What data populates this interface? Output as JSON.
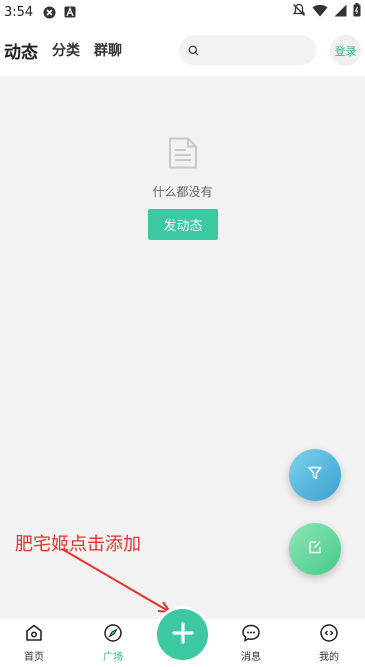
{
  "status_bar": {
    "time": "3:54",
    "icons": [
      "notification-icon",
      "a-icon",
      "mute-icon",
      "wifi-icon",
      "signal-icon",
      "battery-icon"
    ]
  },
  "header": {
    "tabs": [
      {
        "label": "动态",
        "active": true
      },
      {
        "label": "分类",
        "active": false
      },
      {
        "label": "群聊",
        "active": false
      }
    ],
    "search": {
      "placeholder": "",
      "value": ""
    },
    "login_label": "登录"
  },
  "main": {
    "empty_text": "什么都没有",
    "post_button_label": "发动态"
  },
  "annotation": {
    "text": "肥宅姬点击添加"
  },
  "bottom_nav": {
    "items": [
      {
        "label": "首页",
        "icon": "home-icon",
        "active": false
      },
      {
        "label": "广场",
        "icon": "compass-icon",
        "active": true
      },
      {
        "label": "消息",
        "icon": "chat-icon",
        "active": false
      },
      {
        "label": "我的",
        "icon": "profile-icon",
        "active": false
      }
    ]
  },
  "colors": {
    "accent": "#3cc8a0",
    "annotation": "#e0332c"
  }
}
